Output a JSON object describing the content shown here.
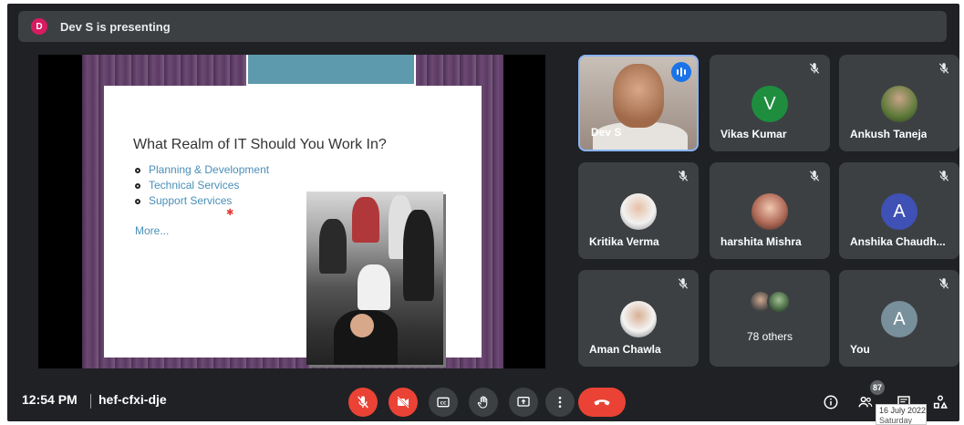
{
  "header": {
    "presenter_initial": "D",
    "presenting_text": "Dev S is presenting",
    "presenter_color": "#d81b60"
  },
  "slide": {
    "title": "What Realm of IT Should You Work In?",
    "bullets": [
      "Planning & Development",
      "Technical Services",
      "Support Services"
    ],
    "more": "More...",
    "accent_color": "#4a8fb8"
  },
  "participants": [
    {
      "name": "Dev S",
      "type": "photo",
      "speaking": true,
      "muted": false
    },
    {
      "name": "Vikas Kumar",
      "type": "initial",
      "initial": "V",
      "color": "#1e8e3e",
      "muted": true
    },
    {
      "name": "Ankush Taneja",
      "type": "photo",
      "muted": true
    },
    {
      "name": "Kritika Verma",
      "type": "photo",
      "muted": true
    },
    {
      "name": "harshita Mishra",
      "type": "photo",
      "muted": true
    },
    {
      "name": "Anshika Chaudh...",
      "type": "initial",
      "initial": "A",
      "color": "#3f51b5",
      "muted": true
    },
    {
      "name": "Aman Chawla",
      "type": "photo",
      "muted": true
    },
    {
      "name": "78 others",
      "type": "group"
    },
    {
      "name": "You",
      "type": "initial",
      "initial": "A",
      "color": "#78909c",
      "muted": true
    }
  ],
  "footer": {
    "time": "12:54 PM",
    "meeting_code": "hef-cfxi-dje",
    "people_count": "87"
  },
  "controls": [
    {
      "name": "mic-off",
      "icon": "mic-off-icon",
      "state": "off"
    },
    {
      "name": "camera-off",
      "icon": "camera-off-icon",
      "state": "off"
    },
    {
      "name": "captions",
      "icon": "captions-icon"
    },
    {
      "name": "raise-hand",
      "icon": "hand-icon"
    },
    {
      "name": "present-now",
      "icon": "present-icon"
    },
    {
      "name": "more-options",
      "icon": "more-vert-icon"
    },
    {
      "name": "leave-call",
      "icon": "end-call-icon"
    }
  ],
  "taskbar": {
    "date": "16 July 2022",
    "day": "Saturday"
  },
  "colors": {
    "background": "#202124",
    "tile": "#3c4043",
    "danger": "#ea4335",
    "speaking": "#1a73e8"
  }
}
